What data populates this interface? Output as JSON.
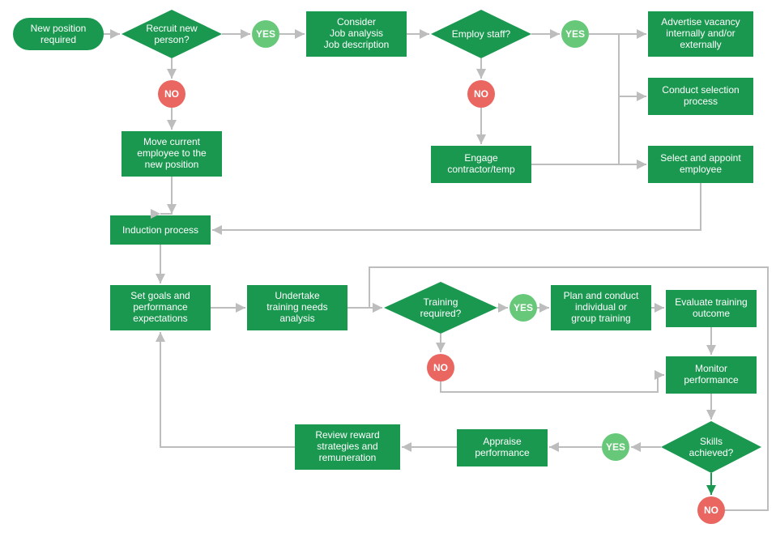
{
  "start": {
    "label": "New position required"
  },
  "d1": {
    "label": "Recruit new person?"
  },
  "b_consider": {
    "l1": "Consider",
    "l2": "Job analysis",
    "l3": "Job description"
  },
  "d2": {
    "label": "Employ staff?"
  },
  "b_advertise": {
    "l1": "Advertise vacancy",
    "l2": "internally and/or",
    "l3": "externally"
  },
  "b_conduct": {
    "l1": "Conduct selection",
    "l2": "process"
  },
  "b_select": {
    "l1": "Select and appoint",
    "l2": "employee"
  },
  "b_engage": {
    "l1": "Engage",
    "l2": "contractor/temp"
  },
  "b_move": {
    "l1": "Move current",
    "l2": "employee to the",
    "l3": "new position"
  },
  "b_induction": {
    "l1": "Induction process"
  },
  "b_goals": {
    "l1": "Set goals and",
    "l2": "performance",
    "l3": "expectations"
  },
  "b_analysis": {
    "l1": "Undertake",
    "l2": "training needs",
    "l3": "analysis"
  },
  "d3": {
    "label": "Training required?"
  },
  "b_plan": {
    "l1": "Plan and conduct",
    "l2": "individual or",
    "l3": "group training"
  },
  "b_evaluate": {
    "l1": "Evaluate training",
    "l2": "outcome"
  },
  "b_monitor": {
    "l1": "Monitor",
    "l2": "performance"
  },
  "d4": {
    "label": "Skills achieved?"
  },
  "b_appraise": {
    "l1": "Appraise",
    "l2": "performance"
  },
  "b_review": {
    "l1": "Review reward",
    "l2": "strategies and",
    "l3": "remuneration"
  },
  "labels": {
    "yes": "YES",
    "no": "NO"
  }
}
